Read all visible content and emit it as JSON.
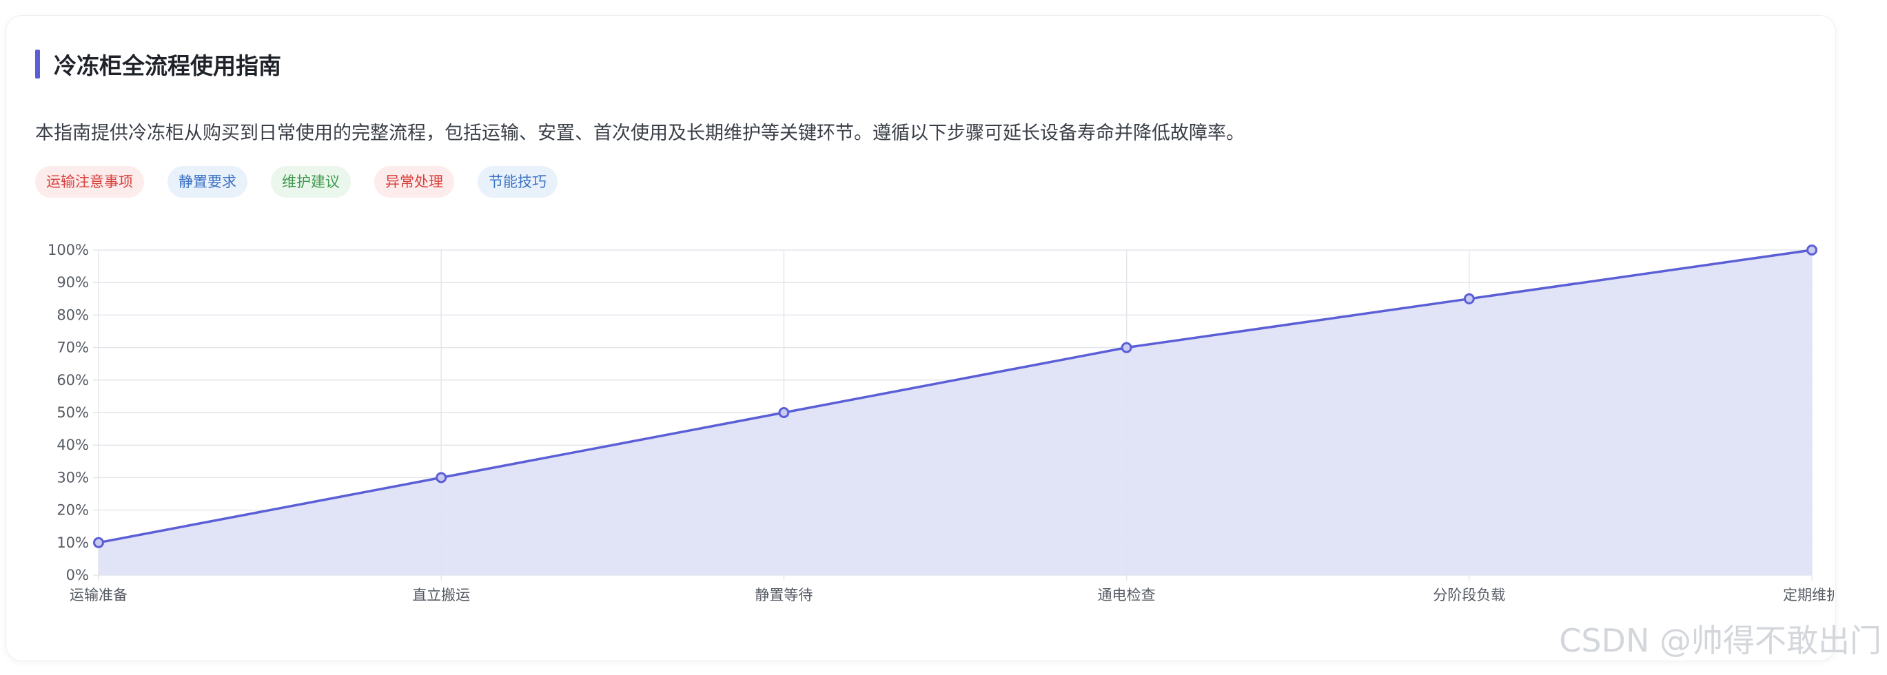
{
  "header": {
    "title": "冷冻柜全流程使用指南",
    "description": "本指南提供冷冻柜从购买到日常使用的完整流程，包括运输、安置、首次使用及长期维护等关键环节。遵循以下步骤可延长设备寿命并降低故障率。"
  },
  "tags": [
    {
      "label": "运输注意事项",
      "color": "#d9413d",
      "bg": "#fdecec"
    },
    {
      "label": "静置要求",
      "color": "#3b72c4",
      "bg": "#e9f1fb"
    },
    {
      "label": "维护建议",
      "color": "#3d9a4d",
      "bg": "#ebf6ed"
    },
    {
      "label": "异常处理",
      "color": "#d9413d",
      "bg": "#fdecec"
    },
    {
      "label": "节能技巧",
      "color": "#3b72c4",
      "bg": "#e9f1fb"
    }
  ],
  "colors": {
    "accent": "#5b5fd6",
    "area_fill": "#dfe1f5",
    "grid": "#e4e6eb",
    "tick_text": "#555a63"
  },
  "chart_data": {
    "type": "area",
    "categories": [
      "运输准备",
      "直立搬运",
      "静置等待",
      "通电检查",
      "分阶段负载",
      "定期维护"
    ],
    "values": [
      10,
      30,
      50,
      70,
      85,
      100
    ],
    "y_ticks": [
      "0%",
      "10%",
      "20%",
      "30%",
      "40%",
      "50%",
      "60%",
      "70%",
      "80%",
      "90%",
      "100%"
    ],
    "ylim": [
      0,
      100
    ],
    "grid": true
  },
  "watermark": "CSDN @帅得不敢出门"
}
